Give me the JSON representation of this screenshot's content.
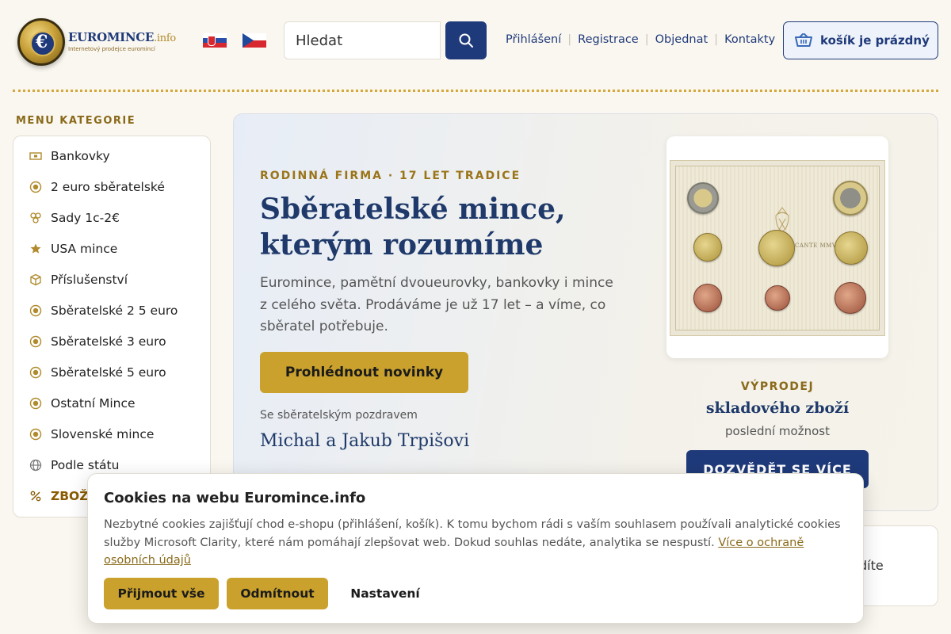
{
  "header": {
    "logo": {
      "name": "EUROMINCE",
      "suffix": ".info",
      "tagline": "Internetový prodejce euromincí",
      "symbol": "€"
    },
    "languages": [
      "Slovensky",
      "Česky"
    ],
    "search": {
      "placeholder": "Hledat"
    },
    "nav": [
      {
        "label": "Přihlášení"
      },
      {
        "label": "Registrace"
      },
      {
        "label": "Objednat"
      },
      {
        "label": "Kontakty"
      }
    ],
    "cart_label": "košík je prázdný"
  },
  "sidebar": {
    "title": "MENU KATEGORIE",
    "items": [
      {
        "label": "Bankovky",
        "icon": "banknote-icon"
      },
      {
        "label": "2 euro sběratelské",
        "icon": "coin-icon"
      },
      {
        "label": "Sady 1c-2€",
        "icon": "coin-set-icon"
      },
      {
        "label": "USA mince",
        "icon": "star-icon"
      },
      {
        "label": "Příslušenství",
        "icon": "box-icon"
      },
      {
        "label": "Sběratelské 2 5 euro",
        "icon": "coin-icon"
      },
      {
        "label": "Sběratelské 3 euro",
        "icon": "coin-icon"
      },
      {
        "label": "Sběratelské 5 euro",
        "icon": "coin-icon"
      },
      {
        "label": "Ostatní Mince",
        "icon": "coin-icon"
      },
      {
        "label": "Slovenské mince",
        "icon": "coin-icon"
      },
      {
        "label": "Podle státu",
        "icon": "globe-icon"
      },
      {
        "label": "ZBOŽ",
        "icon": "percent-icon"
      }
    ]
  },
  "hero": {
    "kicker": "RODINNÁ FIRMA · 17 LET TRADICE",
    "title": "Sběratelské mince, kterým rozumíme",
    "text": "Euromince, pamětní dvoueurovky, bankovky i mince z celého světa. Prodáváme je už 17 let – a víme, co sběratel potřebuje.",
    "button": "Prohlédnout novinky",
    "greeting": "Se sběratelským pozdravem",
    "signature": "Michal a Jakub Trpišovi",
    "product": {
      "set_label": "SEDE VACANTE MMV",
      "sale_kicker": "VÝPRODEJ",
      "sale_title": "skladového zboží",
      "sale_sub": "poslední možnost",
      "sale_button": "DOZVĚDĚT SE VÍCE"
    }
  },
  "second_card_text": "díte",
  "cookie": {
    "title": "Cookies na webu Euromince.info",
    "text": "Nezbytné cookies zajišťují chod e-shopu (přihlášení, košík). K tomu bychom rádi s vaším souhlasem používali analytické cookies služby Microsoft Clarity, které nám pomáhají zlepšovat web. Dokud souhlas nedáte, analytika se nespustí.",
    "link": "Více o ochraně osobních údajů",
    "accept": "Přijmout vše",
    "reject": "Odmítnout",
    "settings": "Nastavení"
  },
  "colors": {
    "brand_blue": "#1f3a7a",
    "gold": "#c9a12c",
    "background": "#faf7f0"
  }
}
